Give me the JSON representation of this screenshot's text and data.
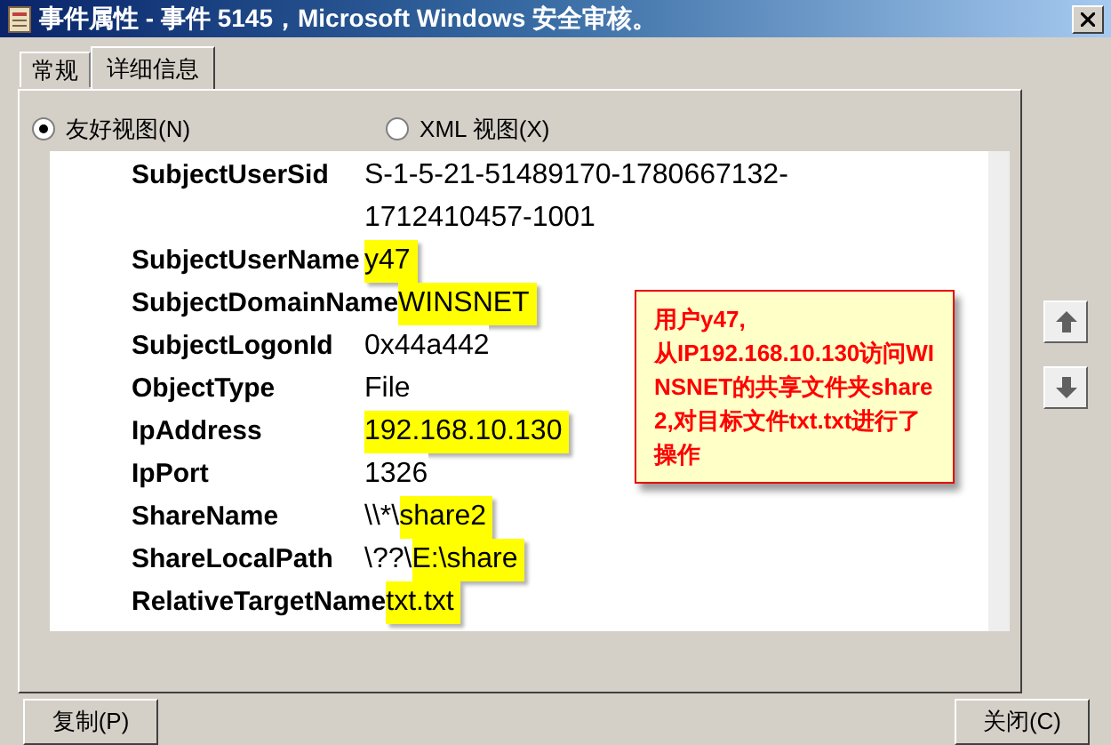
{
  "window": {
    "title": "事件属性 - 事件 5145，Microsoft Windows 安全审核。"
  },
  "tabs": [
    {
      "label": "常规",
      "selected": false
    },
    {
      "label": "详细信息",
      "selected": true
    }
  ],
  "view_options": [
    {
      "label": "友好视图(N)",
      "selected": true
    },
    {
      "label": "XML 视图(X)",
      "selected": false
    }
  ],
  "details": [
    {
      "name": "SubjectUserSid",
      "value": [
        {
          "text": "S-1-5-21-51489170-1780667132-1712410457-1001",
          "highlighted": false
        }
      ]
    },
    {
      "name": "SubjectUserName",
      "value": [
        {
          "text": "y47",
          "highlighted": true
        }
      ]
    },
    {
      "name": "SubjectDomainName",
      "value": [
        {
          "text": "WINSNET",
          "highlighted": true
        }
      ]
    },
    {
      "name": "SubjectLogonId",
      "value": [
        {
          "text": "0x44a442",
          "highlighted": false
        }
      ]
    },
    {
      "name": "ObjectType",
      "value": [
        {
          "text": "File",
          "highlighted": false
        }
      ]
    },
    {
      "name": "IpAddress",
      "value": [
        {
          "text": "192.168.10.130",
          "highlighted": true
        }
      ]
    },
    {
      "name": "IpPort",
      "value": [
        {
          "text": "1326",
          "highlighted": false
        }
      ]
    },
    {
      "name": "ShareName",
      "value": [
        {
          "text": "\\\\*\\",
          "highlighted": false
        },
        {
          "text": "share2",
          "highlighted": true
        }
      ]
    },
    {
      "name": "ShareLocalPath",
      "value": [
        {
          "text": "\\??\\",
          "highlighted": false
        },
        {
          "text": "E:\\share",
          "highlighted": true
        }
      ]
    },
    {
      "name": "RelativeTargetName",
      "value": [
        {
          "text": "txt.txt",
          "highlighted": true
        }
      ]
    }
  ],
  "annotation": "用户y47,\n从IP192.168.10.130访问WINSNET的共享文件夹share2,对目标文件txt.txt进行了操作",
  "buttons": {
    "copy": "复制(P)",
    "close": "关闭(C)"
  }
}
